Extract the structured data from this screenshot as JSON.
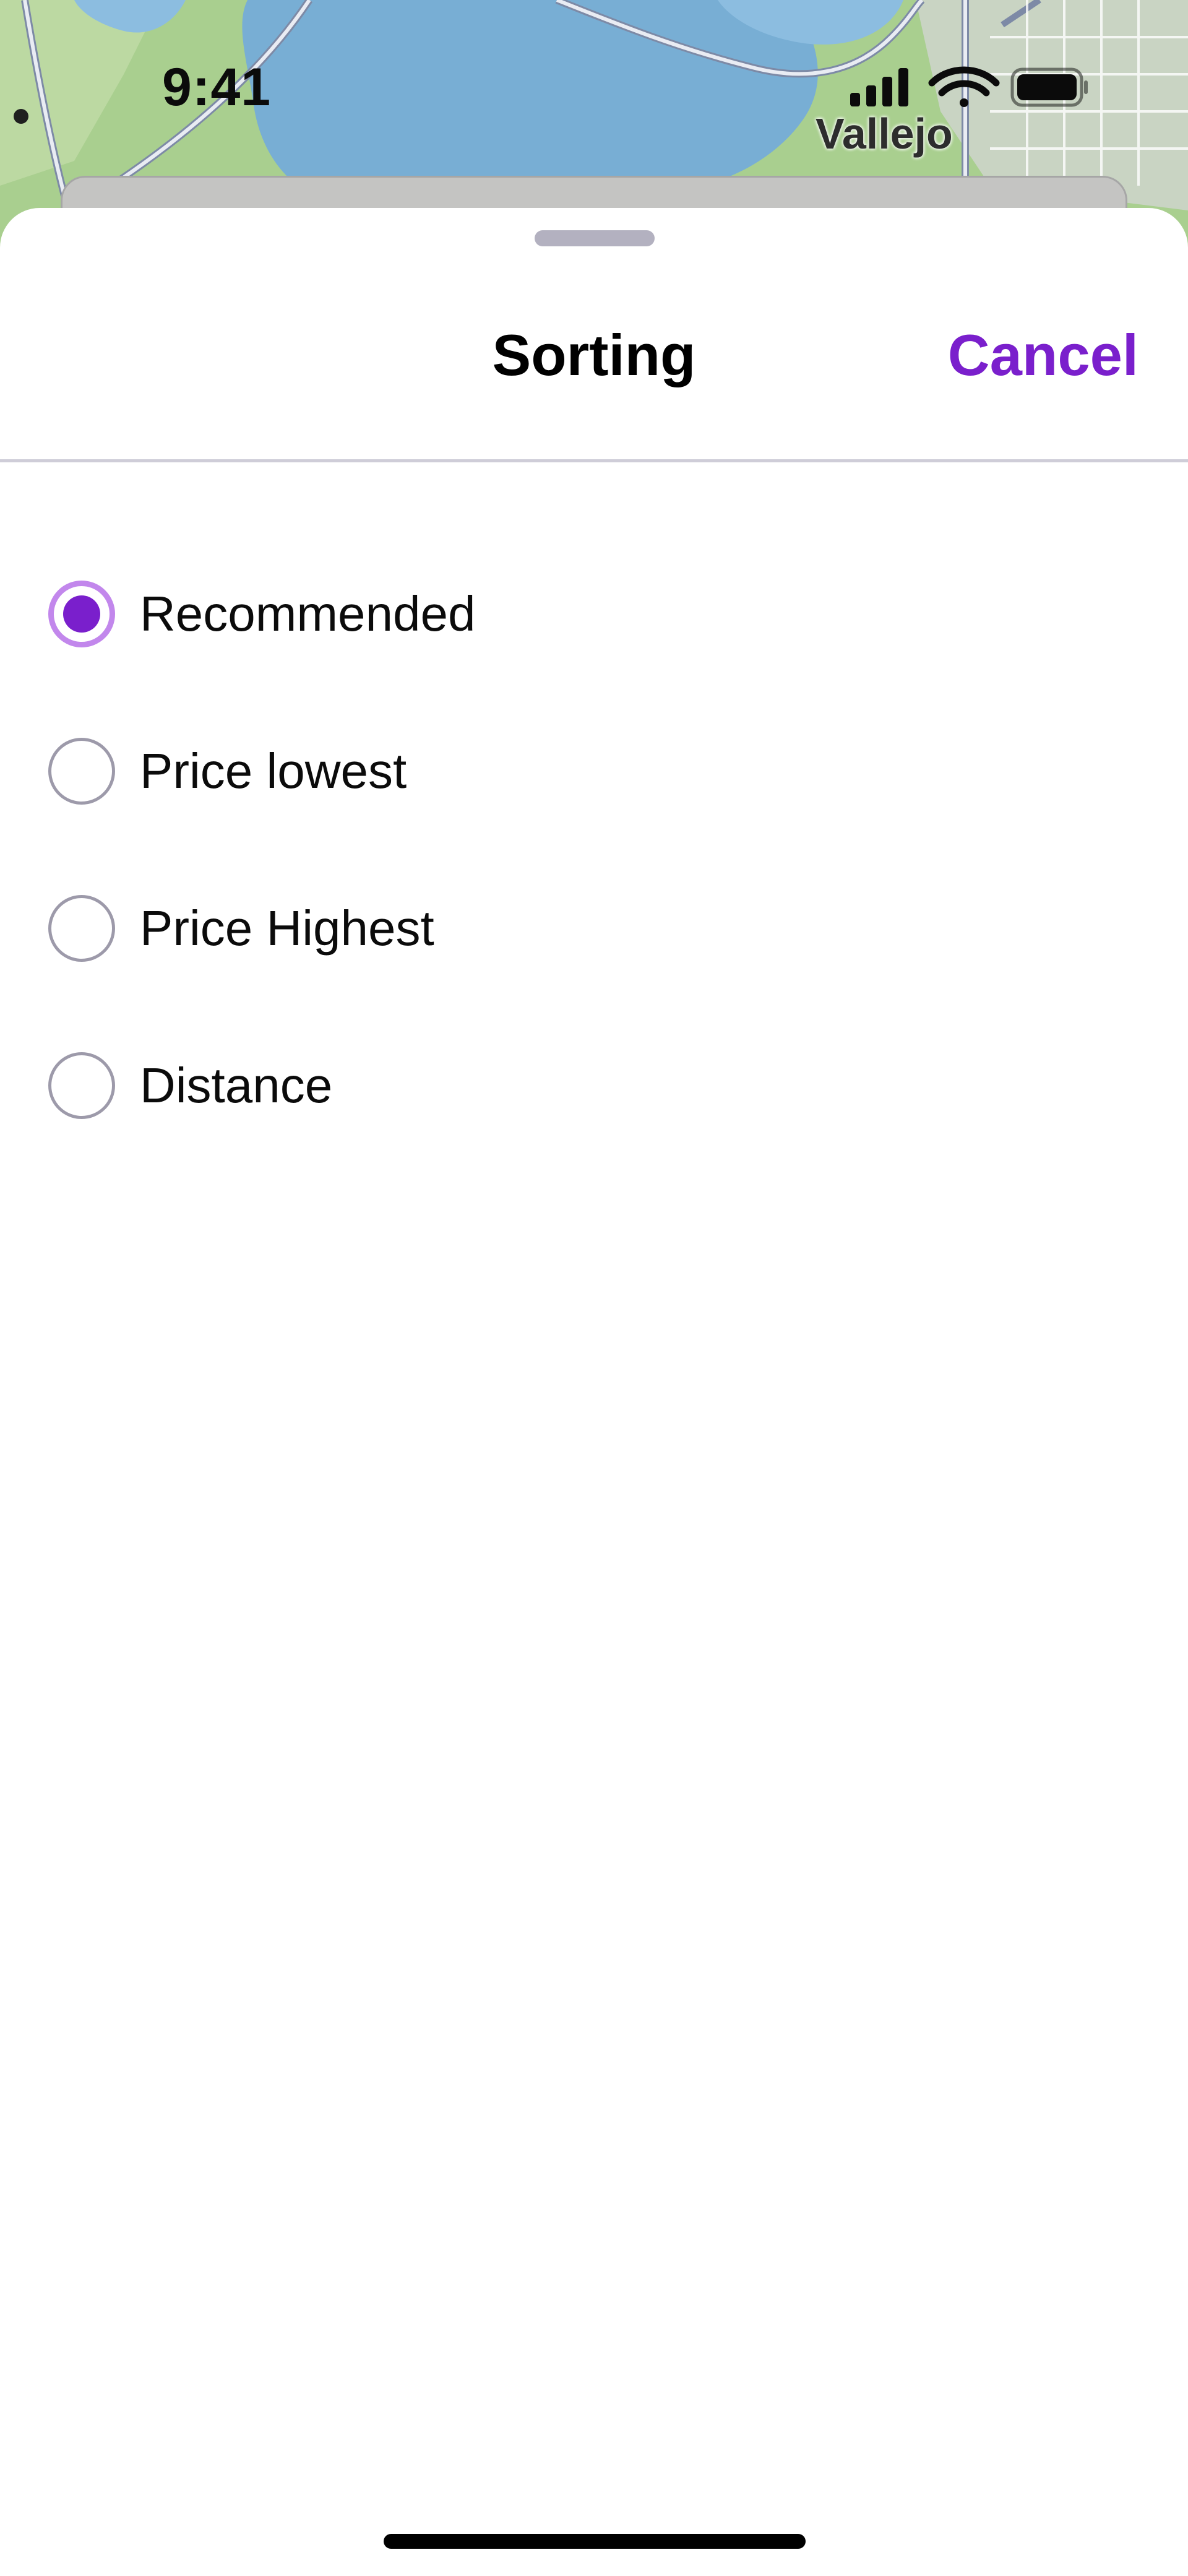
{
  "status_bar": {
    "time": "9:41",
    "icons": [
      "signal-icon",
      "wifi-icon",
      "battery-icon"
    ]
  },
  "map": {
    "place_label": "Vallejo"
  },
  "sheet": {
    "title": "Sorting",
    "cancel_label": "Cancel",
    "options": [
      {
        "label": "Recommended",
        "selected": true
      },
      {
        "label": "Price lowest",
        "selected": false
      },
      {
        "label": "Price Highest",
        "selected": false
      },
      {
        "label": "Distance",
        "selected": false
      }
    ]
  },
  "colors": {
    "accent": "#7a1fcc",
    "radio_ring_selected": "#c287ec",
    "radio_ring": "#9d9aaa",
    "map_land": "#a9cf8f",
    "map_water": "#78aed4"
  }
}
